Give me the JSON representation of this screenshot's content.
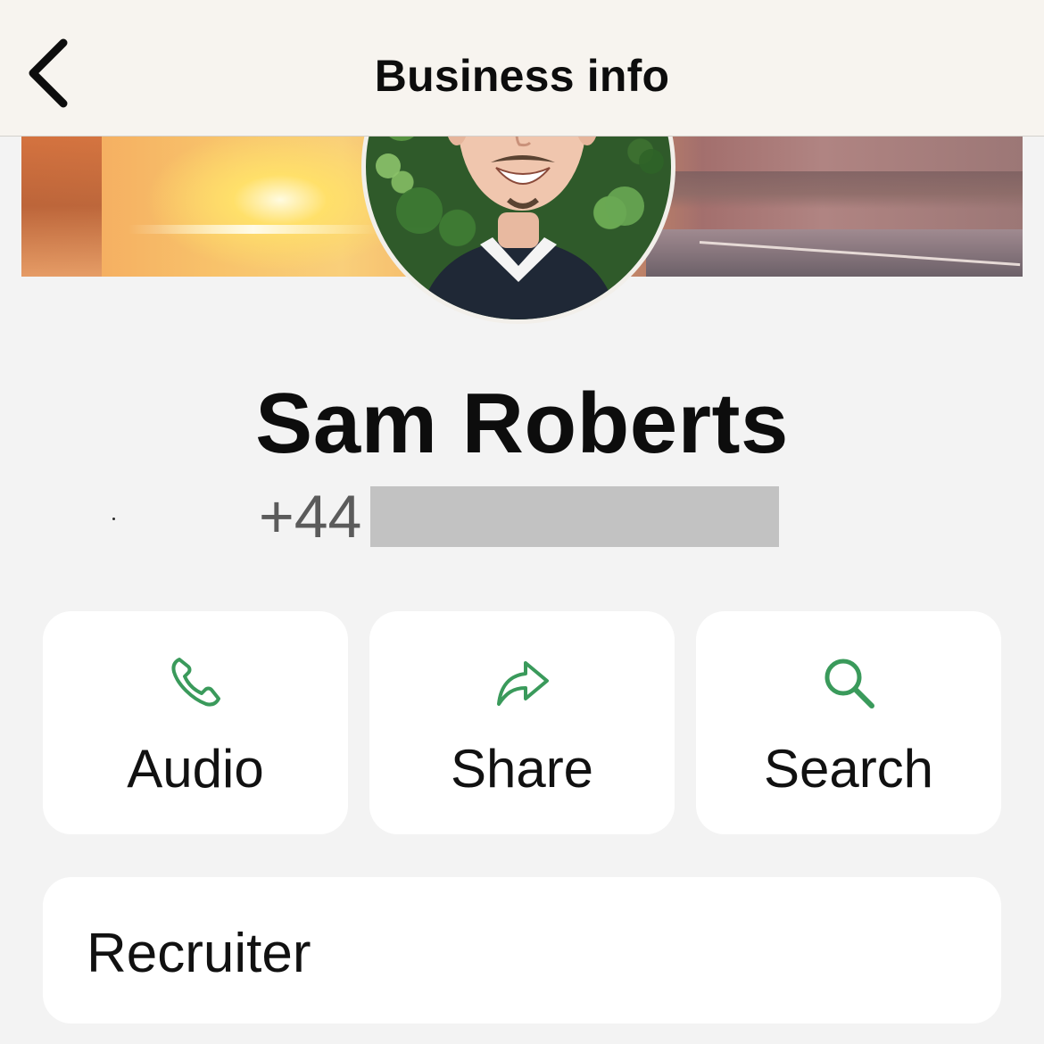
{
  "nav": {
    "title": "Business info",
    "back_icon": "chevron-left-icon"
  },
  "profile": {
    "name": "Sam Roberts",
    "phone_prefix": "+44",
    "phone_number_redacted": true
  },
  "actions": [
    {
      "label": "Audio",
      "icon": "phone-icon"
    },
    {
      "label": "Share",
      "icon": "share-arrow-icon"
    },
    {
      "label": "Search",
      "icon": "magnifier-icon"
    }
  ],
  "category": {
    "label": "Recruiter"
  },
  "colors": {
    "accent_green": "#3a9a5b",
    "background": "#f3f3f3",
    "card": "#ffffff",
    "nav_bar": "#f7f4ef",
    "phone_text": "#5b5b5b",
    "redaction": "#c2c2c2"
  }
}
